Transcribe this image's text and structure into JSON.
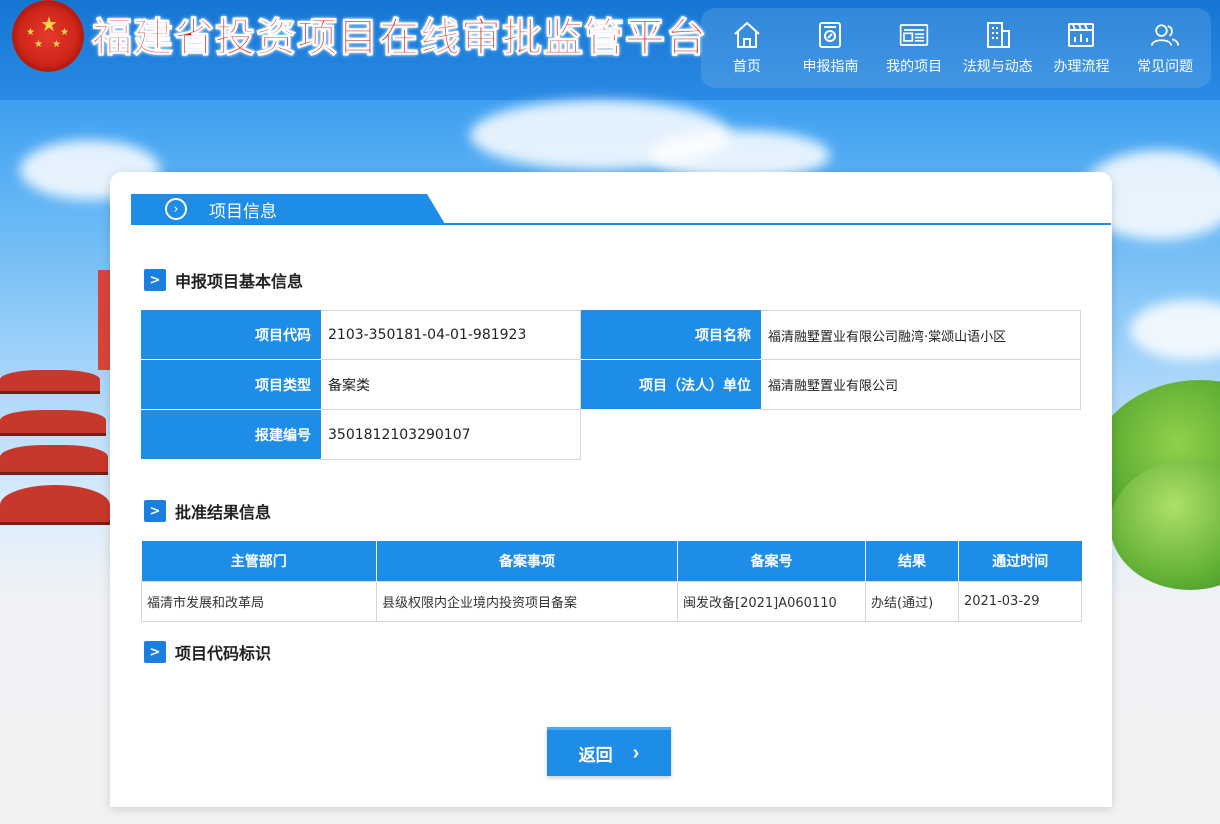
{
  "header": {
    "site_title": "福建省投资项目在线审批监管平台",
    "nav": [
      {
        "label": "首页",
        "icon": "home-icon"
      },
      {
        "label": "申报指南",
        "icon": "guide-icon"
      },
      {
        "label": "我的项目",
        "icon": "project-icon"
      },
      {
        "label": "法规与动态",
        "icon": "building-icon"
      },
      {
        "label": "办理流程",
        "icon": "flow-icon"
      },
      {
        "label": "常见问题",
        "icon": "users-icon"
      }
    ]
  },
  "card": {
    "tab_label": "项目信息",
    "basic_section_title": "申报项目基本信息",
    "basic": {
      "code_label": "项目代码",
      "code_value": "2103-350181-04-01-981923",
      "name_label": "项目名称",
      "name_value": "福清融墅置业有限公司融湾·棠颂山语小区",
      "type_label": "项目类型",
      "type_value": "备案类",
      "unit_label": "项目（法人）单位",
      "unit_value": "福清融墅置业有限公司",
      "report_label": "报建编号",
      "report_value": "3501812103290107"
    },
    "approval_section_title": "批准结果信息",
    "approval_headers": [
      "主管部门",
      "备案事项",
      "备案号",
      "结果",
      "通过时间"
    ],
    "approval_rows": [
      [
        "福清市发展和改革局",
        "县级权限内企业境内投资项目备案",
        "闽发改备[2021]A060110",
        "办结(通过)",
        "2021-03-29"
      ]
    ],
    "code_section_title": "项目代码标识",
    "back_button": "返回"
  },
  "colors": {
    "primary": "#1e8de8",
    "title_red": "#d8241c"
  }
}
